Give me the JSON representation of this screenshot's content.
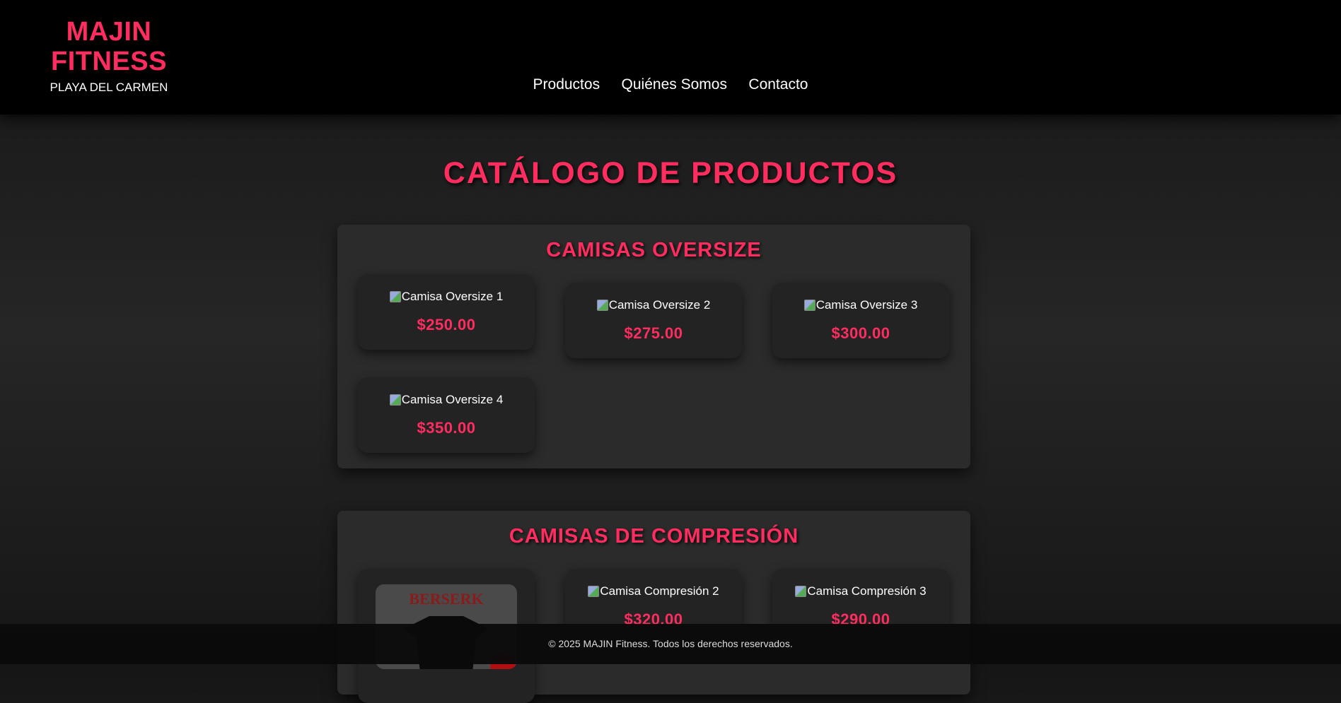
{
  "brand": {
    "title": "MAJIN FITNESS",
    "subtitle": "PLAYA DEL CARMEN"
  },
  "nav": {
    "items": [
      {
        "label": "Productos"
      },
      {
        "label": "Quiénes Somos"
      },
      {
        "label": "Contacto"
      }
    ]
  },
  "page": {
    "title": "CATÁLOGO DE PRODUCTOS"
  },
  "sections": [
    {
      "title": "CAMISAS OVERSIZE",
      "products": [
        {
          "alt": "Camisa Oversize 1",
          "price": "$250.00"
        },
        {
          "alt": "Camisa Oversize 2",
          "price": "$275.00"
        },
        {
          "alt": "Camisa Oversize 3",
          "price": "$300.00"
        },
        {
          "alt": "Camisa Oversize 4",
          "price": "$350.00"
        }
      ]
    },
    {
      "title": "CAMISAS DE COMPRESIÓN",
      "products": [
        {
          "image_text": "BERSERK"
        },
        {
          "alt": "Camisa Compresión 2",
          "price": "$320.00"
        },
        {
          "alt": "Camisa Compresión 3",
          "price": "$290.00"
        }
      ]
    }
  ],
  "footer": {
    "text": "© 2025 MAJIN Fitness. Todos los derechos reservados."
  },
  "colors": {
    "accent": "#ff2d5f",
    "header_bg": "#000000",
    "card_bg": "#232323",
    "section_bg": "#2b2b2b"
  }
}
